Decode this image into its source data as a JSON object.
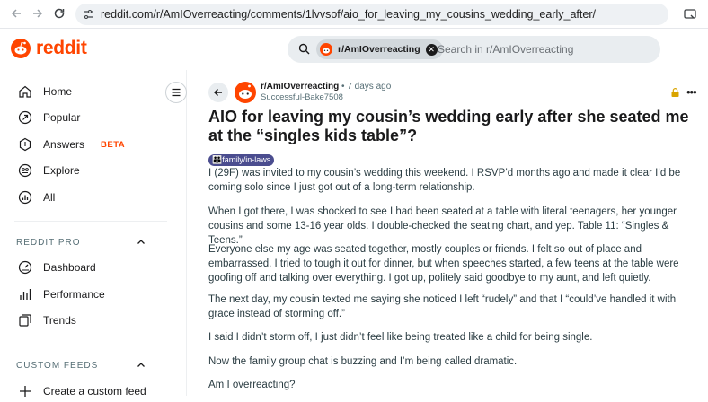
{
  "browser": {
    "url_host": "reddit.com",
    "url_path": "/r/AmIOverreacting/comments/1lvvsof/aio_for_leaving_my_cousins_wedding_early_after/"
  },
  "header": {
    "logo_text": "reddit",
    "search_chip": "r/AmIOverreacting",
    "search_placeholder": "Search in r/AmIOverreacting"
  },
  "sidebar": {
    "items": [
      {
        "label": "Home",
        "icon": "home-icon"
      },
      {
        "label": "Popular",
        "icon": "popular-icon"
      },
      {
        "label": "Answers",
        "badge": "BETA",
        "icon": "answers-icon"
      },
      {
        "label": "Explore",
        "icon": "explore-icon"
      },
      {
        "label": "All",
        "icon": "all-icon"
      }
    ],
    "pro_title": "REDDIT PRO",
    "pro_items": [
      {
        "label": "Dashboard",
        "icon": "dashboard-icon"
      },
      {
        "label": "Performance",
        "icon": "performance-icon"
      },
      {
        "label": "Trends",
        "icon": "trends-icon"
      }
    ],
    "feeds_title": "CUSTOM FEEDS",
    "feeds_items": [
      {
        "label": "Create a custom feed",
        "icon": "plus-icon"
      }
    ]
  },
  "post": {
    "subreddit": "r/AmIOverreacting",
    "time": "• 7 days ago",
    "author": "Successful-Bake7508",
    "title": "AIO for leaving my cousin’s wedding early after she seated me at the “singles kids table”?",
    "flair": "👪family/in-laws",
    "paragraphs": [
      "I (29F) was invited to my cousin’s wedding this weekend. I RSVP’d months ago and made it clear I’d be coming solo since I just got out of a long-term relationship.",
      "When I got there, I was shocked to see I had been seated at a table with literal teenagers, her younger cousins and some 13-16 year olds. I double-checked the seating chart, and yep. Table 11: “Singles & Teens.”",
      "Everyone else my age was seated together, mostly couples or friends. I felt so out of place and embarrassed. I tried to tough it out for dinner, but when speeches started, a few teens at the table were goofing off and talking over everything. I got up, politely said goodbye to my aunt, and left quietly.",
      "The next day, my cousin texted me saying she noticed I left “rudely” and that I “could’ve handled it with grace instead of storming off.”",
      "I said I didn’t storm off, I just didn’t feel like being treated like a child for being single.",
      "Now the family group chat is buzzing and I’m being called dramatic.",
      "Am I overreacting?"
    ]
  },
  "colors": {
    "brand": "#ff4500",
    "flair_bg": "#4b4d8f",
    "beta": "#ff4500"
  }
}
